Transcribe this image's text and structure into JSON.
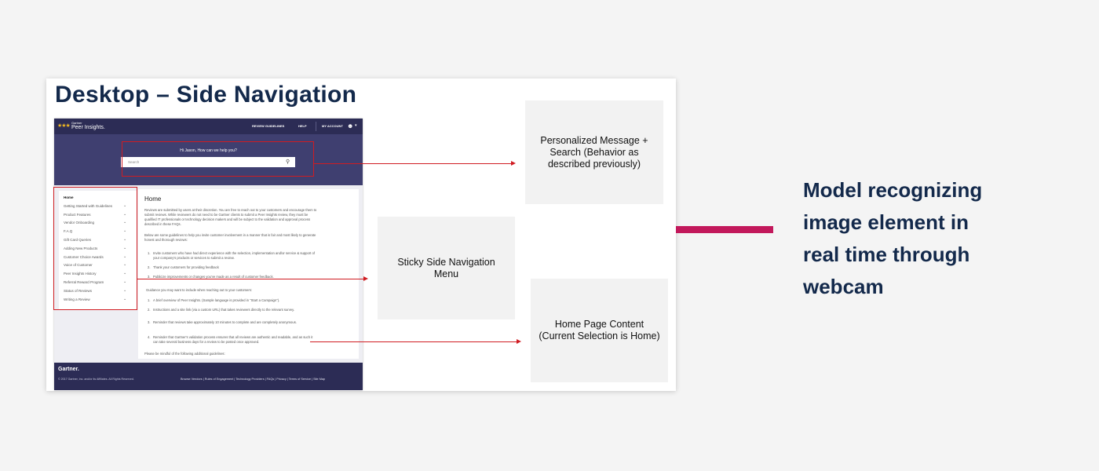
{
  "slide_title": "Desktop – Side Navigation",
  "screenshot": {
    "brand_top": "Gartner",
    "brand_name": "Peer Insights.",
    "nav": {
      "review_guidelines": "REVIEW GUIDELINES",
      "help": "HELP",
      "my_account": "MY ACCOUNT"
    },
    "greeting": "Hi Jason, How can we help you?",
    "search_placeholder": "Search",
    "sidenav": [
      "Home",
      "Getting Started with Guidelines",
      "Product Features",
      "Vendor Onboarding",
      "F.A.Q",
      "Gift Card Queries",
      "Adding New Products",
      "Customer Choice Awards",
      "Voice of Customer",
      "Peer Insights History",
      "Referral Reward Program",
      "Status of Reviews",
      "Writing a Review"
    ],
    "content": {
      "title": "Home",
      "p1": "Reviews are submitted by users at their discretion. You are free to reach out to your customers and encourage them to submit reviews. While reviewers do not need to be Gartner clients to submit a Peer Insights review, they must be qualified IT professionals or technology decision makers and will be subject to the validation and approval process described in these FAQs.",
      "p2": "Below are some guidelines to help you invite customer involvement in a manner that is fair and most likely to generate honest and thorough reviews:",
      "list1": [
        "Invite customers who have had direct experience with the selection, implementation and/or service & support of your company's products or services to submit a review.",
        "Thank your customers for providing feedback",
        "Publicize improvements or changes you've made as a result of customer feedback."
      ],
      "p3": "Guidance you may want to include when reaching out to your customers:",
      "list2": [
        "A brief overview of Peer Insights. (Sample language is provided in \"Start a Campaign\").",
        "Instructions and a site link (via a custom URL) that takes reviewers directly to the relevant survey.",
        "Reminder that reviews take approximately 10 minutes to complete and are completely anonymous.",
        "Reminder that Gartner's validation process ensures that all reviews are authentic and readable, and as such it can take several business days for a review to be posted once approved."
      ],
      "p4": "Please be mindful of the following additional guidelines:"
    },
    "footer": {
      "brand": "Gartner.",
      "copyright": "© 2017 Gartner, Inc. and/or its Affiliates. All Rights Reserved.",
      "links": "Browse Vendors  |  Rules of Engagement  |  Technology Providers  |  FAQs  |  Privacy  |  Terms of Service  |  Site Map"
    }
  },
  "callouts": {
    "search": "Personalized Message + Search (Behavior as described previously)",
    "sidenav": "Sticky Side Navigation Menu",
    "content": "Home Page Content (Current Selection is Home)"
  },
  "right_text": "Model recognizing\nimage element in\nreal time through\nwebcam",
  "colors": {
    "navy": "#13294b",
    "accent_pink": "#c2185b",
    "highlight_red": "#d01c22",
    "header_purple": "#2c2c55"
  }
}
